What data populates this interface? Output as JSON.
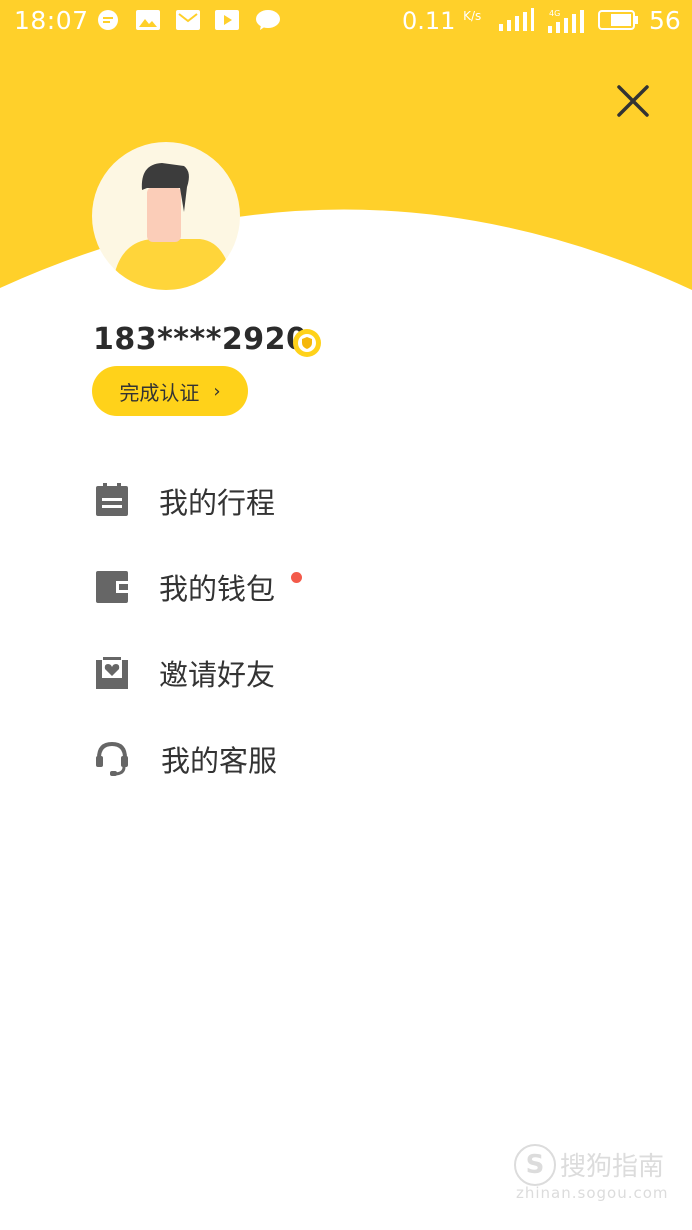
{
  "status_bar": {
    "time": "18:07",
    "net_speed": "0.11",
    "net_unit": "K/s",
    "network_type": "4G",
    "battery": "56",
    "notification_icons": [
      "chat-bubble-icon",
      "image-icon",
      "mail-icon",
      "video-play-icon",
      "message-icon"
    ]
  },
  "colors": {
    "header": "#ffd02a",
    "accent": "#ffd21a",
    "icon": "#666666",
    "badge_dot": "#f35a4a"
  },
  "profile": {
    "phone": "183****2920",
    "auth_button": "完成认证",
    "auth_chevron": "›"
  },
  "menu": [
    {
      "label": "我的行程",
      "icon": "trip-icon",
      "badge": false
    },
    {
      "label": "我的钱包",
      "icon": "wallet-icon",
      "badge": true
    },
    {
      "label": "邀请好友",
      "icon": "invite-icon",
      "badge": false
    },
    {
      "label": "我的客服",
      "icon": "headset-icon",
      "badge": false
    }
  ],
  "watermark": {
    "logo": "S",
    "text": "搜狗指南",
    "url": "zhinan.sogou.com"
  }
}
